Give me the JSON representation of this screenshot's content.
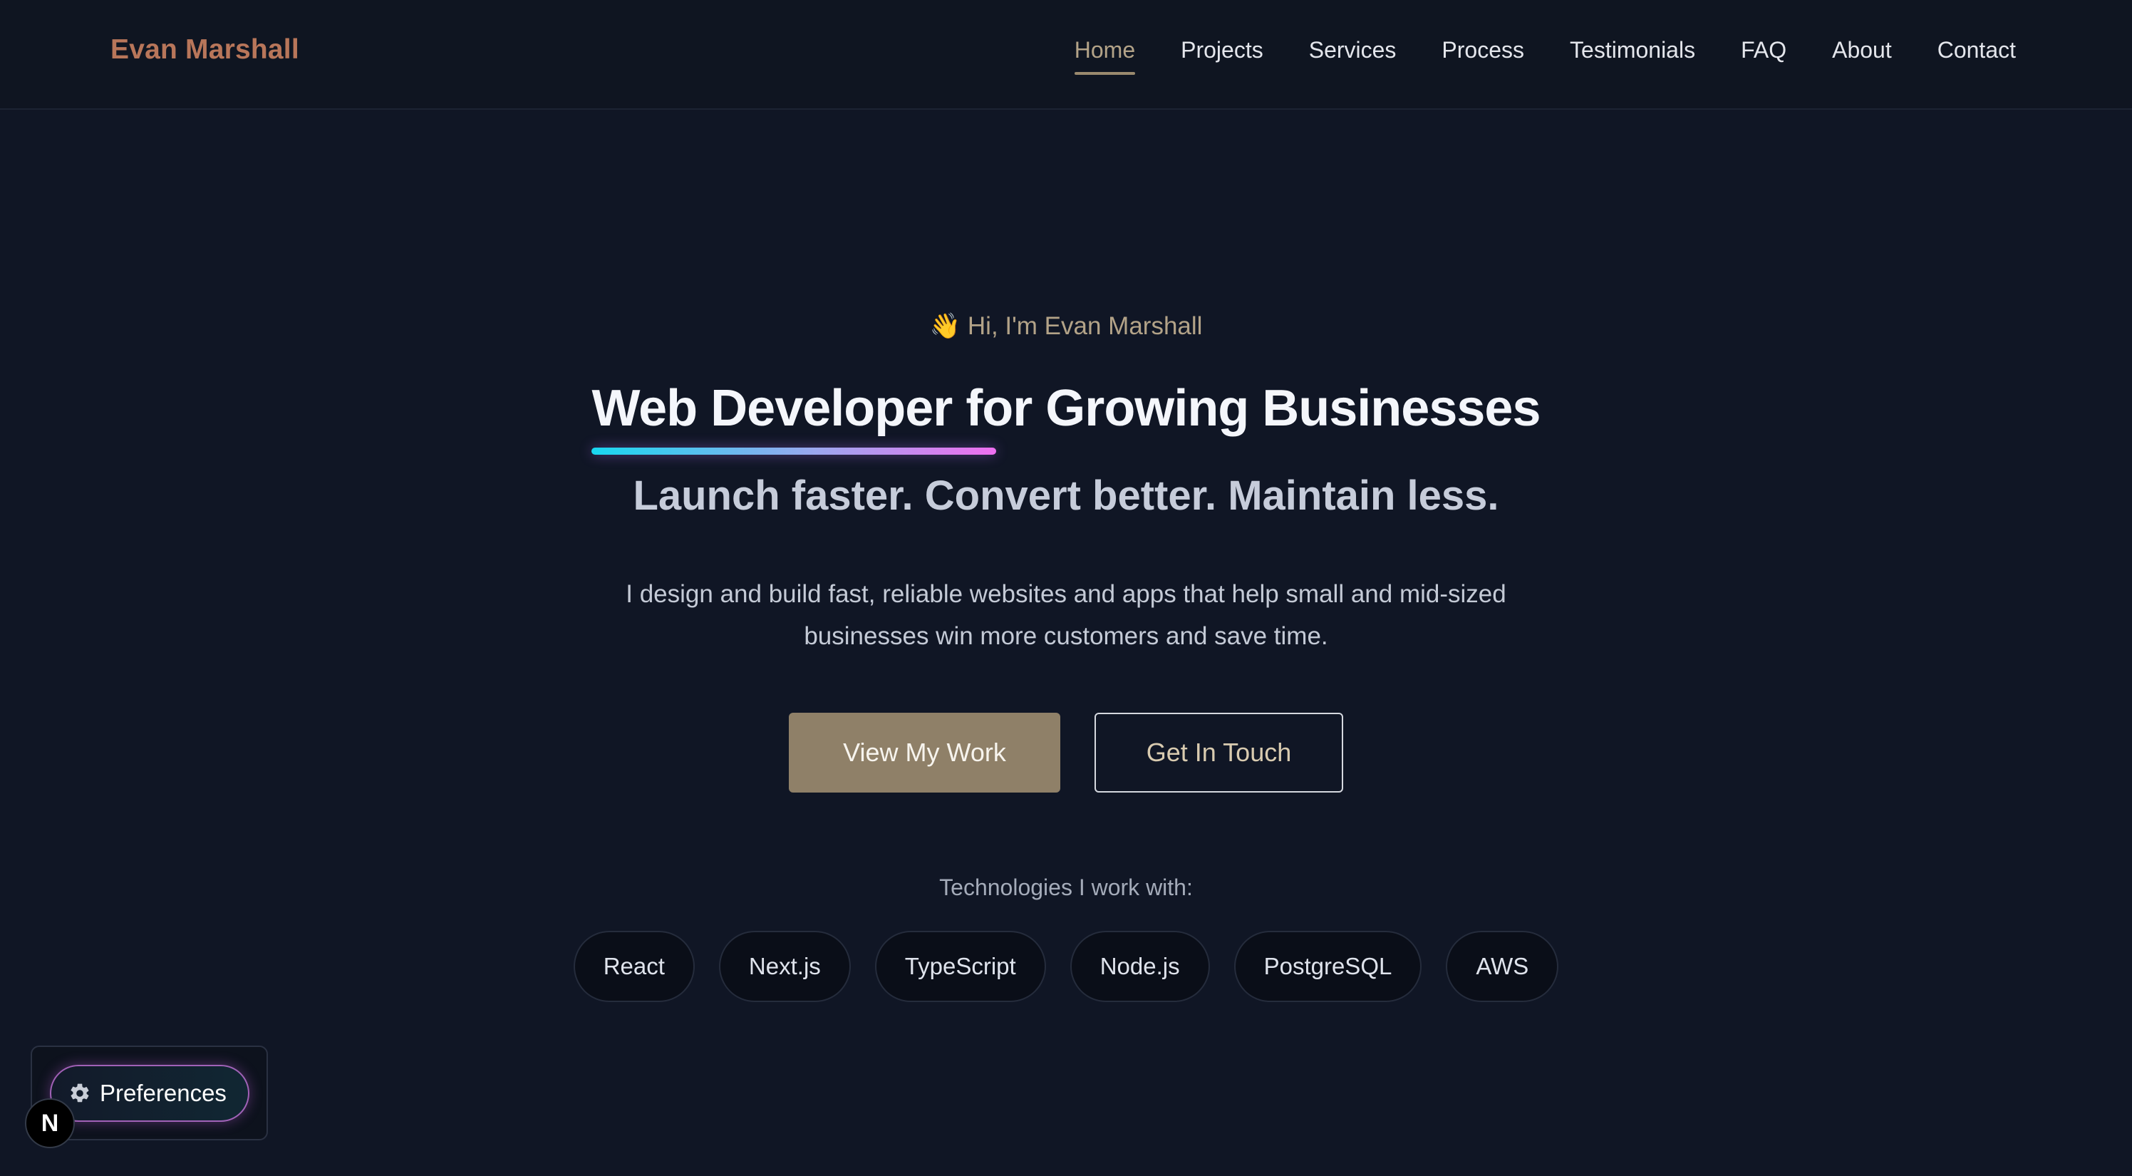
{
  "header": {
    "brand": "Evan Marshall",
    "nav": [
      {
        "label": "Home",
        "active": true
      },
      {
        "label": "Projects",
        "active": false
      },
      {
        "label": "Services",
        "active": false
      },
      {
        "label": "Process",
        "active": false
      },
      {
        "label": "Testimonials",
        "active": false
      },
      {
        "label": "FAQ",
        "active": false
      },
      {
        "label": "About",
        "active": false
      },
      {
        "label": "Contact",
        "active": false
      }
    ]
  },
  "hero": {
    "greeting_icon": "👋",
    "greeting": "Hi, I'm Evan Marshall",
    "title": "Web Developer for Growing Businesses",
    "subtitle": "Launch faster. Convert better. Maintain less.",
    "description": "I design and build fast, reliable websites and apps that help small and mid-sized businesses win more customers and save time.",
    "primary_cta": "View My Work",
    "secondary_cta": "Get In Touch",
    "tech_label": "Technologies I work with:",
    "technologies": [
      "React",
      "Next.js",
      "TypeScript",
      "Node.js",
      "PostgreSQL",
      "AWS"
    ]
  },
  "widgets": {
    "preferences_label": "Preferences",
    "preferences_icon": "gear-icon",
    "nextjs_badge_letter": "N"
  },
  "colors": {
    "background": "#101625",
    "brand": "#b8765a",
    "accent": "#8f8068",
    "nav_active": "#b3a388"
  }
}
